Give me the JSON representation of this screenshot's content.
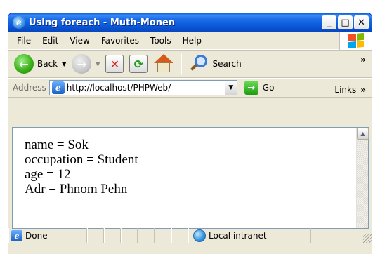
{
  "window": {
    "title": "Using foreach - Muth-Monen",
    "caption_buttons": {
      "minimize": "_",
      "maximize": "□",
      "close": "✕"
    }
  },
  "menubar": {
    "items": [
      {
        "label": "File",
        "accel": "F"
      },
      {
        "label": "Edit",
        "accel": "E"
      },
      {
        "label": "View",
        "accel": "V"
      },
      {
        "label": "Favorites",
        "accel": "a"
      },
      {
        "label": "Tools",
        "accel": "T"
      },
      {
        "label": "Help",
        "accel": "H"
      }
    ]
  },
  "toolbar": {
    "back_label": "Back",
    "search_label": "Search",
    "overflow": "»"
  },
  "addressbar": {
    "label": "Address",
    "url": "http://localhost/PHPWeb/",
    "go_label": "Go",
    "links_label": "Links",
    "links_overflow": "»"
  },
  "content": {
    "lines": [
      "name = Sok",
      "occupation = Student",
      "age = 12",
      "Adr = Phnom Pehn"
    ]
  },
  "statusbar": {
    "status_text": "Done",
    "zone_text": "Local intranet"
  },
  "colors": {
    "title_bar": "#0a58d8",
    "chrome": "#ece9d8",
    "content_bg": "#ffffff"
  }
}
